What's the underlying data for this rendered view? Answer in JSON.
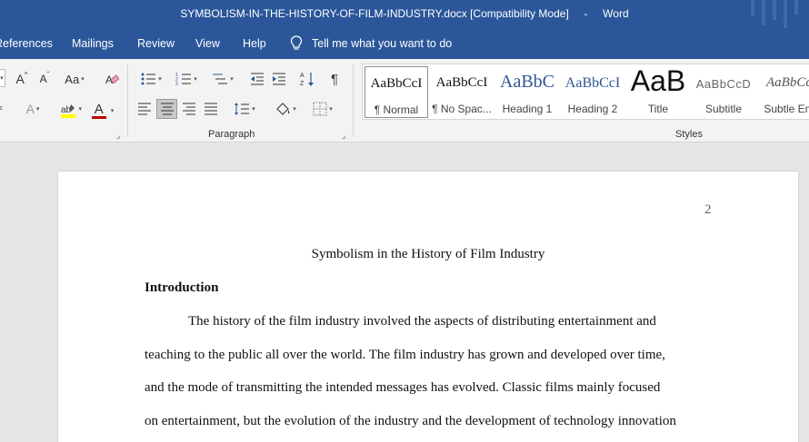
{
  "titlebar": {
    "doc_name": "SYMBOLISM-IN-THE-HISTORY-OF-FILM-INDUSTRY.docx [Compatibility Mode]",
    "separator": "-",
    "app": "Word"
  },
  "tabs": [
    {
      "label": "References"
    },
    {
      "label": "Mailings"
    },
    {
      "label": "Review"
    },
    {
      "label": "View"
    },
    {
      "label": "Help"
    }
  ],
  "tell_me": {
    "label": "Tell me what you want to do",
    "icon": "lightbulb-icon"
  },
  "ribbon": {
    "font_group": {
      "grow_label": "A",
      "shrink_label": "A",
      "case_label": "Aa",
      "text_effects_label": "A",
      "font_color_label": "A",
      "highlight_color": "#ffff00",
      "font_color": "#c00000"
    },
    "paragraph_label": "Paragraph",
    "styles_label": "Styles",
    "styles": [
      {
        "preview": "AaBbCcI",
        "name": "¶ Normal"
      },
      {
        "preview": "AaBbCcI",
        "name": "¶ No Spac..."
      },
      {
        "preview": "AaBbC",
        "name": "Heading 1"
      },
      {
        "preview": "AaBbCcI",
        "name": "Heading 2"
      },
      {
        "preview": "AaB",
        "name": "Title"
      },
      {
        "preview": "AaBbCcD",
        "name": "Subtitle"
      },
      {
        "preview": "AaBbCc",
        "name": "Subtle Em"
      }
    ]
  },
  "document": {
    "page_number": "2",
    "title": "Symbolism in the History of Film Industry",
    "heading": "Introduction",
    "lines": [
      "The history of the film industry involved the aspects of distributing entertainment and",
      "teaching to the public all over the world. The film industry has grown and developed over time,",
      "and the mode of transmitting the intended messages has evolved. Classic films mainly focused",
      "on entertainment, but the evolution of the industry and the development of technology innovation"
    ]
  },
  "colors": {
    "word_blue": "#2b579a",
    "ribbon_bg": "#f3f3f3",
    "canvas_bg": "#e6e6e6",
    "heading_blue": "#2f5496"
  }
}
